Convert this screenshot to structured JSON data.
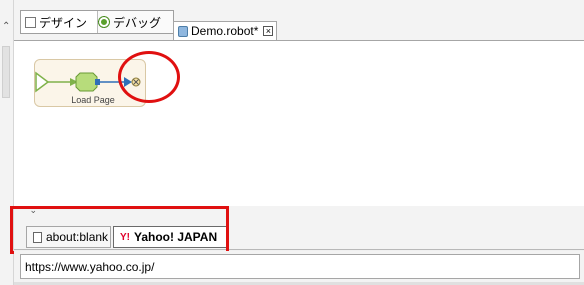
{
  "toolbar": {
    "design_label": "デザイン",
    "debug_label": "デバッグ"
  },
  "editor_tab": {
    "title": "Demo.robot*",
    "close": "×"
  },
  "flow": {
    "node_label": "Load Page"
  },
  "browser_tabs": [
    {
      "label": "about:blank"
    },
    {
      "label": "Yahoo! JAPAN",
      "icon_text": "Y!"
    }
  ],
  "url_bar": {
    "value": "https://www.yahoo.co.jp/"
  },
  "colors": {
    "highlight": "#e01010",
    "node_fill": "#b7dc7b",
    "flow_line": "#2f6fb8",
    "yahoo_red": "#e0002a"
  }
}
